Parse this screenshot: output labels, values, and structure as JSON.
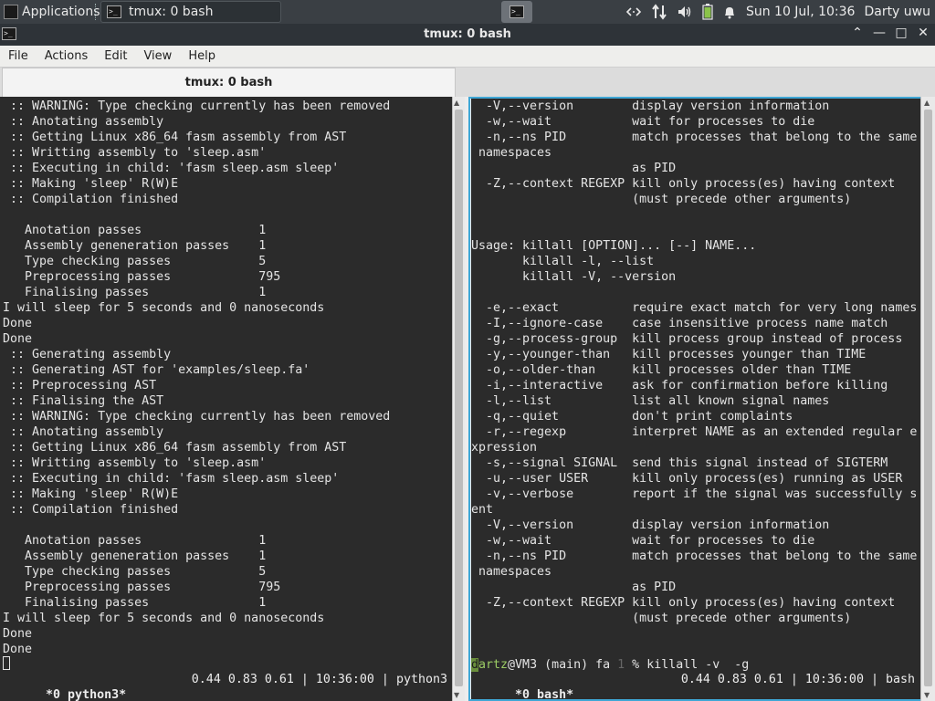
{
  "panel": {
    "apps_label": "Applications",
    "task_label": "tmux: 0 bash",
    "clock": "Sun 10 Jul, 10:36",
    "user": "Darty uwu",
    "accent": "#3fa7d6",
    "tray_icons": [
      "network-arrows-icon",
      "transfer-arrows-icon",
      "volume-icon",
      "battery-icon",
      "bell-icon"
    ]
  },
  "window": {
    "title": "tmux: 0 bash",
    "menu": [
      "File",
      "Actions",
      "Edit",
      "View",
      "Help"
    ],
    "tab_label": "tmux: 0 bash"
  },
  "left_pane": {
    "lines": [
      " :: WARNING: Type checking currently has been removed",
      " :: Anotating assembly",
      " :: Getting Linux x86_64 fasm assembly from AST",
      " :: Writting assembly to 'sleep.asm'",
      " :: Executing in child: 'fasm sleep.asm sleep'",
      " :: Making 'sleep' R(W)E",
      " :: Compilation finished",
      "",
      "   Anotation passes                1",
      "   Assembly geneneration passes    1",
      "   Type checking passes            5",
      "   Preprocessing passes            795",
      "   Finalising passes               1",
      "I will sleep for 5 seconds and 0 nanoseconds",
      "Done",
      "Done",
      " :: Generating assembly",
      " :: Generating AST for 'examples/sleep.fa'",
      " :: Preprocessing AST",
      " :: Finalising the AST",
      " :: WARNING: Type checking currently has been removed",
      " :: Anotating assembly",
      " :: Getting Linux x86_64 fasm assembly from AST",
      " :: Writting assembly to 'sleep.asm'",
      " :: Executing in child: 'fasm sleep.asm sleep'",
      " :: Making 'sleep' R(W)E",
      " :: Compilation finished",
      "",
      "   Anotation passes                1",
      "   Assembly geneneration passes    1",
      "   Type checking passes            5",
      "   Preprocessing passes            795",
      "   Finalising passes               1",
      "I will sleep for 5 seconds and 0 nanoseconds",
      "Done",
      "Done"
    ],
    "status_window": " *0 python3*",
    "status_right": "0.44 0.83 0.61 | 10:36:00 | python3"
  },
  "right_pane": {
    "lines": [
      "  -V,--version        display version information",
      "  -w,--wait           wait for processes to die",
      "  -n,--ns PID         match processes that belong to the same",
      " namespaces",
      "                      as PID",
      "  -Z,--context REGEXP kill only process(es) having context",
      "                      (must precede other arguments)",
      "",
      "",
      "Usage: killall [OPTION]... [--] NAME...",
      "       killall -l, --list",
      "       killall -V, --version",
      "",
      "  -e,--exact          require exact match for very long names",
      "  -I,--ignore-case    case insensitive process name match",
      "  -g,--process-group  kill process group instead of process",
      "  -y,--younger-than   kill processes younger than TIME",
      "  -o,--older-than     kill processes older than TIME",
      "  -i,--interactive    ask for confirmation before killing",
      "  -l,--list           list all known signal names",
      "  -q,--quiet          don't print complaints",
      "  -r,--regexp         interpret NAME as an extended regular e",
      "xpression",
      "  -s,--signal SIGNAL  send this signal instead of SIGTERM",
      "  -u,--user USER      kill only process(es) running as USER",
      "  -v,--verbose        report if the signal was successfully s",
      "ent",
      "  -V,--version        display version information",
      "  -w,--wait           wait for processes to die",
      "  -n,--ns PID         match processes that belong to the same",
      " namespaces",
      "                      as PID",
      "  -Z,--context REGEXP kill only process(es) having context",
      "                      (must precede other arguments)",
      "",
      ""
    ],
    "prompt_user_first": "d",
    "prompt_user_rest": "artz",
    "prompt_host": "@VM3 (main) fa ",
    "prompt_code": "1",
    "prompt_symbol": " % ",
    "prompt_command": "killall -v  -g",
    "status_window": " *0 bash*",
    "status_right": "0.44 0.83 0.61 | 10:36:00 | bash"
  }
}
